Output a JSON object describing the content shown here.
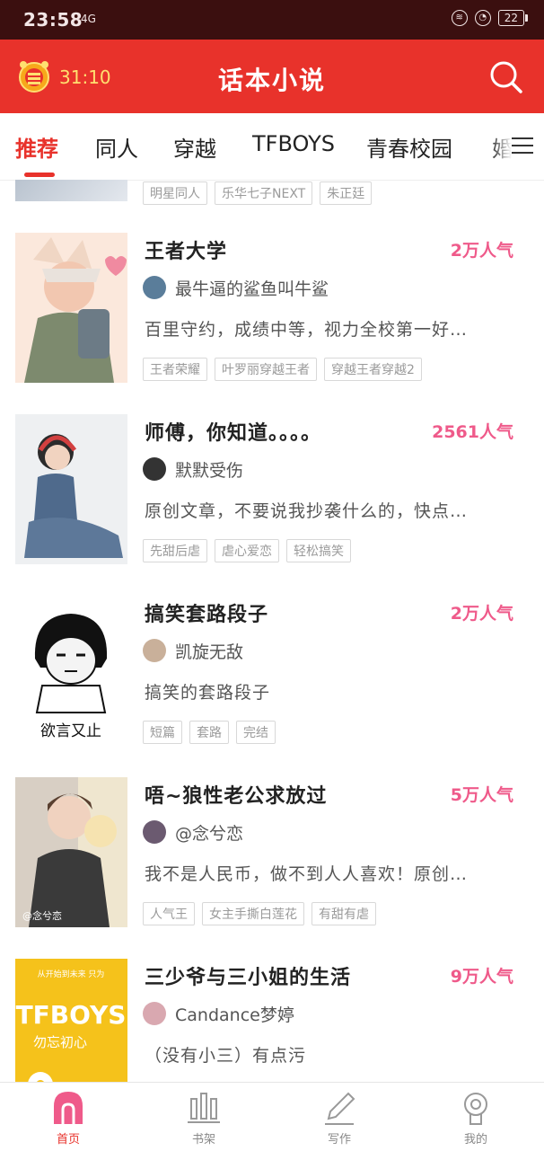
{
  "status_bar": {
    "time": "23:58",
    "signal": "4G",
    "battery": "22"
  },
  "header": {
    "timer": "31:10",
    "title": "话本小说"
  },
  "tabs": [
    {
      "label": "推荐"
    },
    {
      "label": "同人"
    },
    {
      "label": "穿越"
    },
    {
      "label": "TFBOYS"
    },
    {
      "label": "青春校园"
    },
    {
      "label": "婚"
    }
  ],
  "partial_row": {
    "tags": [
      "明星同人",
      "乐华七子NEXT",
      "朱正廷"
    ]
  },
  "books": [
    {
      "title": "王者大学",
      "popularity": "2万人气",
      "author": "最牛逼的鲨鱼叫牛鲨",
      "description": "百里守约，成绩中等，视力全校第一好…",
      "tags": [
        "王者荣耀",
        "叶罗丽穿越王者",
        "穿越王者穿越2"
      ],
      "colors": {
        "cover_a": "#f2c7b0",
        "cover_b": "#7d8a6e",
        "avatar": "#5a7d9a"
      }
    },
    {
      "title": "师傅，你知道。。。。",
      "popularity": "2561人气",
      "author": "默默受伤",
      "description": "原创文章，不要说我抄袭什么的，快点…",
      "tags": [
        "先甜后虐",
        "虐心爱恋",
        "轻松搞笑"
      ],
      "colors": {
        "cover_a": "#e9ecef",
        "cover_b": "#4f6a8c",
        "avatar": "#333333"
      }
    },
    {
      "title": "搞笑套路段子",
      "popularity": "2万人气",
      "author": "凯旋无敌",
      "description": "搞笑的套路段子",
      "tags": [
        "短篇",
        "套路",
        "完结"
      ],
      "cover_caption": "欲言又止",
      "colors": {
        "cover_a": "#ffffff",
        "cover_b": "#111111",
        "avatar": "#c9b09a"
      }
    },
    {
      "title": "唔~狼性老公求放过",
      "popularity": "5万人气",
      "author": "@念兮恋",
      "description": "我不是人民币，做不到人人喜欢！原创…",
      "tags": [
        "人气王",
        "女主手撕白莲花",
        "有甜有虐"
      ],
      "cover_caption": "@念兮恋",
      "colors": {
        "cover_a": "#d8cfc4",
        "cover_b": "#3a3a3a",
        "avatar": "#6b5a70"
      }
    },
    {
      "title": "三少爷与三小姐的生活",
      "popularity": "9万人气",
      "author": "Candance梦婷",
      "description": "（没有小三）有点污",
      "tags": [],
      "cover_caption": "TFBOYS",
      "cover_sub": "勿忘初心",
      "cover_top": "从开始到未来 只为",
      "colors": {
        "cover_a": "#f5c21b",
        "cover_b": "#ffffff",
        "avatar": "#d9a8b0"
      }
    }
  ],
  "bottom_nav": [
    {
      "label": "首页",
      "icon": "home-icon"
    },
    {
      "label": "书架",
      "icon": "bookshelf-icon"
    },
    {
      "label": "写作",
      "icon": "pen-icon"
    },
    {
      "label": "我的",
      "icon": "profile-icon"
    }
  ],
  "colors": {
    "brand": "#e8322b",
    "popularity": "#ef5a8a",
    "statusbar": "#3b0f0f"
  }
}
